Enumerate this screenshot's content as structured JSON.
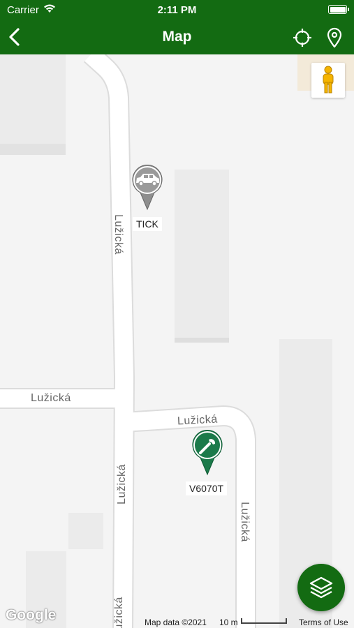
{
  "status_bar": {
    "carrier": "Carrier",
    "time": "2:11 PM"
  },
  "nav": {
    "title": "Map",
    "back_icon": "chevron-left-icon",
    "locate_icon": "crosshair-icon",
    "pin_icon": "map-pin-icon"
  },
  "map": {
    "street_names": {
      "vertical_upper": "Lužická",
      "horizontal_left": "Lužická",
      "horizontal_right": "Lužická",
      "vertical_lower": "Lužická",
      "vertical_right": "Lužická",
      "vertical_bottom": "Lužická"
    },
    "markers": [
      {
        "label": "TICK",
        "icon": "car-icon",
        "color": "#8e8e8e"
      },
      {
        "label": "V6070T",
        "icon": "wrench-icon",
        "color": "#1b7a4a"
      }
    ],
    "pegman_icon": "street-view-person-icon",
    "layers_icon": "layers-icon",
    "attribution": {
      "logo": "Google",
      "map_data": "Map data ©2021",
      "scale": "10 m",
      "terms": "Terms of Use"
    }
  },
  "colors": {
    "brand_green": "#136b12",
    "map_background": "#f4f4f4",
    "road": "#ffffff",
    "building": "#e8e8e8"
  }
}
